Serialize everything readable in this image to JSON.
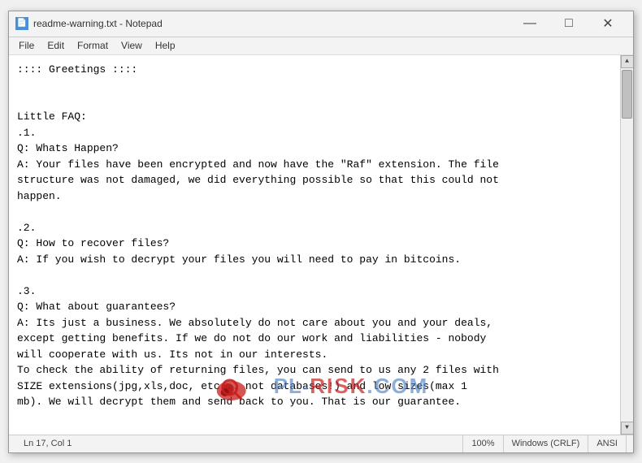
{
  "window": {
    "title": "readme-warning.txt - Notepad",
    "icon_label": "N"
  },
  "title_buttons": {
    "minimize": "—",
    "maximize": "□",
    "close": "✕"
  },
  "menu": {
    "items": [
      "File",
      "Edit",
      "Format",
      "View",
      "Help"
    ]
  },
  "content": {
    "text": ":::: Greetings ::::\n\n\nLittle FAQ:\n.1.\nQ: Whats Happen?\nA: Your files have been encrypted and now have the \"Raf\" extension. The file\nstructure was not damaged, we did everything possible so that this could not\nhappen.\n\n.2.\nQ: How to recover files?\nA: If you wish to decrypt your files you will need to pay in bitcoins.\n\n.3.\nQ: What about guarantees?\nA: Its just a business. We absolutely do not care about you and your deals,\nexcept getting benefits. If we do not do our work and liabilities - nobody\nwill cooperate with us. Its not in our interests.\nTo check the ability of returning files, you can send to us any 2 files with\nSIZE extensions(jpg,xls,doc, etc... not databases!) and low sizes(max 1\nmb). We will decrypt them and send back to you. That is our guarantee."
  },
  "status_bar": {
    "position": "Ln 17, Col 1",
    "zoom": "100%",
    "line_endings": "Windows (CRLF)",
    "encoding": "ANSI"
  },
  "watermark": {
    "text": "risk.com"
  }
}
